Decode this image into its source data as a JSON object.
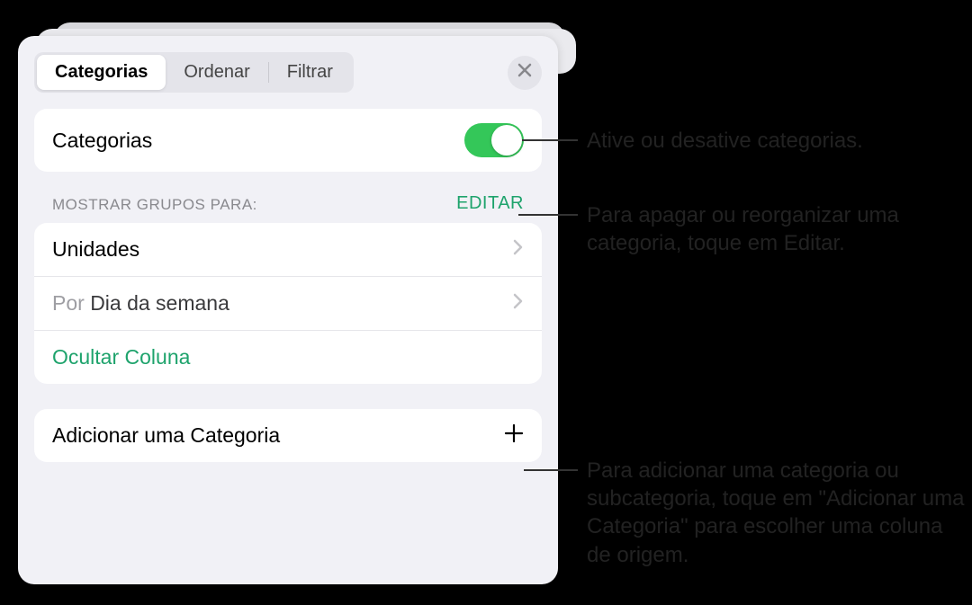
{
  "tabs": {
    "categorias": "Categorias",
    "ordenar": "Ordenar",
    "filtrar": "Filtrar"
  },
  "toggleRow": {
    "title": "Categorias"
  },
  "groupsHeader": {
    "label": "MOSTRAR GRUPOS PARA:",
    "edit": "EDITAR"
  },
  "groups": {
    "item1": "Unidades",
    "item2_prefix": "Por ",
    "item2_value": "Dia da semana",
    "hideColumn": "Ocultar Coluna"
  },
  "addCategory": {
    "label": "Adicionar uma Categoria"
  },
  "callouts": {
    "toggle": "Ative ou desative categorias.",
    "edit": "Para apagar ou reorganizar uma categoria, toque em Editar.",
    "add": "Para adicionar uma categoria ou subcategoria, toque em \"Adicionar uma Categoria\" para escolher uma coluna de origem."
  }
}
